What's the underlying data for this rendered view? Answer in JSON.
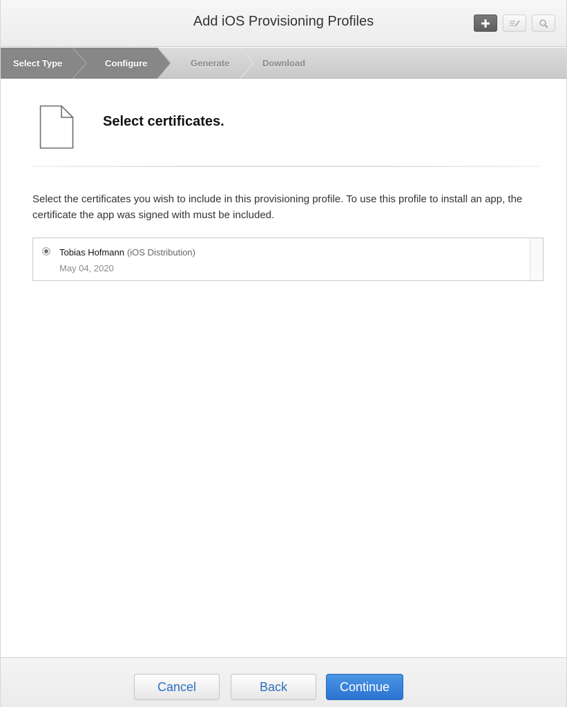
{
  "header": {
    "title": "Add iOS Provisioning Profiles",
    "toolbar_icons": [
      "plus-icon",
      "edit-icon",
      "search-icon"
    ]
  },
  "steps": [
    {
      "label": "Select Type",
      "state": "active"
    },
    {
      "label": "Configure",
      "state": "active"
    },
    {
      "label": "Generate",
      "state": "inactive"
    },
    {
      "label": "Download",
      "state": "inactive"
    }
  ],
  "section": {
    "icon": "document-icon",
    "title": "Select certificates.",
    "description": "Select the certificates you wish to include in this provisioning profile. To use this profile to install an app, the certificate the app was signed with must be included."
  },
  "certificates": [
    {
      "name": "Tobias Hofmann",
      "type": "(iOS Distribution)",
      "date": "May 04, 2020",
      "selected": true
    }
  ],
  "footer": {
    "cancel_label": "Cancel",
    "back_label": "Back",
    "continue_label": "Continue"
  },
  "colors": {
    "step_active": "#808080",
    "primary_button": "#2b73cf",
    "link_text": "#2f6fbd"
  }
}
